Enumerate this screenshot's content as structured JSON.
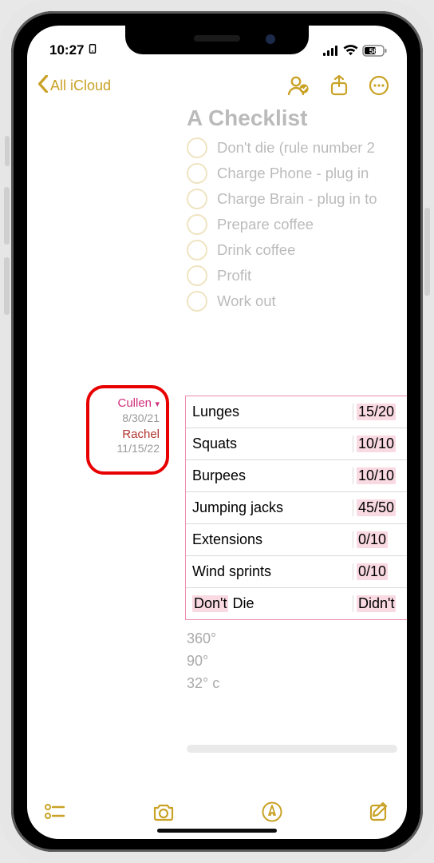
{
  "status": {
    "time": "10:27",
    "battery": "58"
  },
  "nav": {
    "back_label": "All iCloud"
  },
  "note": {
    "title": "A Checklist",
    "checklist": [
      "Don't die (rule number 2",
      "Charge Phone - plug in",
      "Charge Brain - plug in to",
      "Prepare coffee",
      "Drink coffee",
      "Profit",
      "Work out"
    ],
    "footer_lines": [
      "360°",
      "90°",
      "32° c"
    ]
  },
  "attribution": [
    {
      "name": "Cullen",
      "date": "8/30/21",
      "color": "pink",
      "expanded": true
    },
    {
      "name": "Rachel",
      "date": "11/15/22",
      "color": "red",
      "expanded": false
    }
  ],
  "table": {
    "rows": [
      {
        "label": "Lunges",
        "value": "15/20"
      },
      {
        "label": "Squats",
        "value": "10/10"
      },
      {
        "label": "Burpees",
        "value": "10/10"
      },
      {
        "label": "Jumping jacks",
        "value": "45/50"
      },
      {
        "label": "Extensions",
        "value": "0/10"
      },
      {
        "label": "Wind sprints",
        "value": "0/10"
      },
      {
        "label": "Don't Die",
        "value": "Didn't",
        "label_highlight": "Don't"
      }
    ]
  }
}
